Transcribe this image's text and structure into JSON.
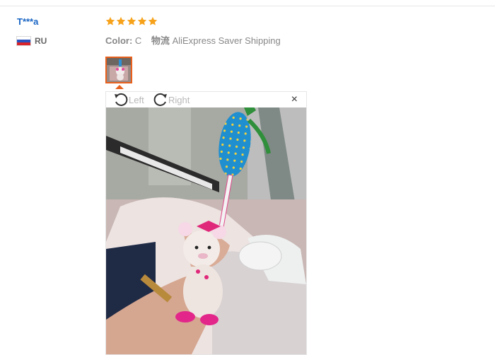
{
  "reviewer": {
    "name": "T***a",
    "country_code": "RU"
  },
  "rating": {
    "stars": 5,
    "max": 5,
    "color": "#f7a21b"
  },
  "details": {
    "color_label": "Color:",
    "color_value": "C",
    "shipping_label": "物流",
    "shipping_value": "AliExpress Saver Shipping"
  },
  "viewer": {
    "rotate_left_label": "Left",
    "rotate_right_label": "Right",
    "close_glyph": "×"
  },
  "colors": {
    "accent": "#e8601c",
    "link": "#1a66c4"
  }
}
